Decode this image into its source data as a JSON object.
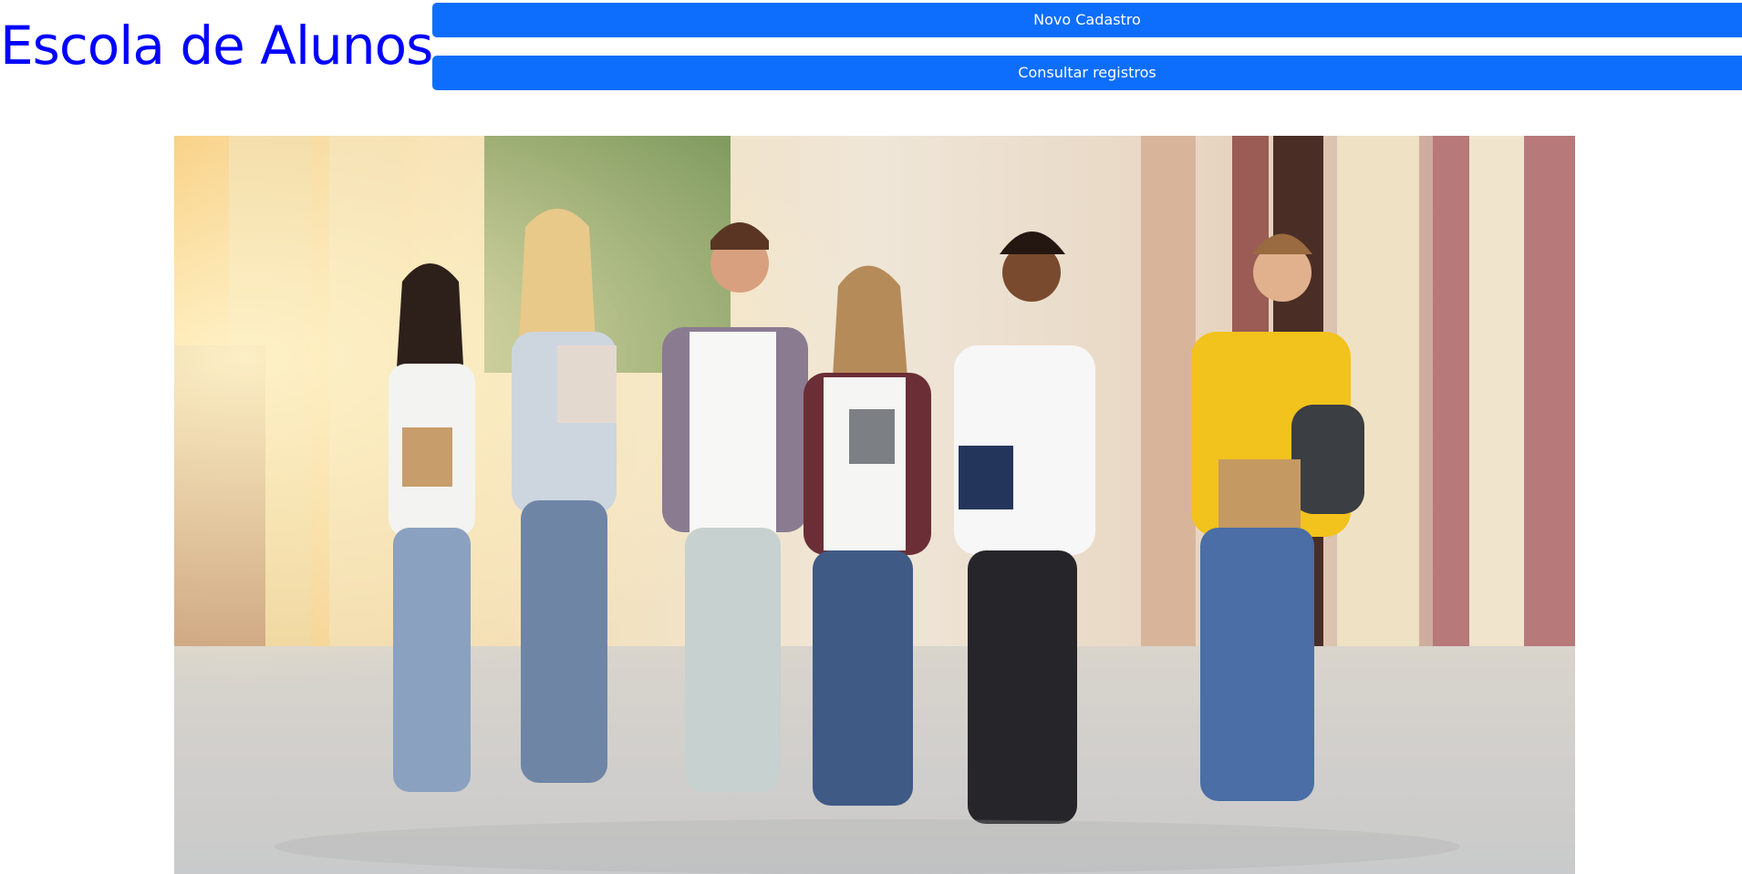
{
  "header": {
    "title": "Escola de Alunos",
    "title_color": "#0000ff"
  },
  "nav": {
    "new_record_label": "Novo Cadastro",
    "consult_records_label": "Consultar registros",
    "button_color": "#0d6efd"
  },
  "hero_image": {
    "subject": "students-walking-photo"
  }
}
